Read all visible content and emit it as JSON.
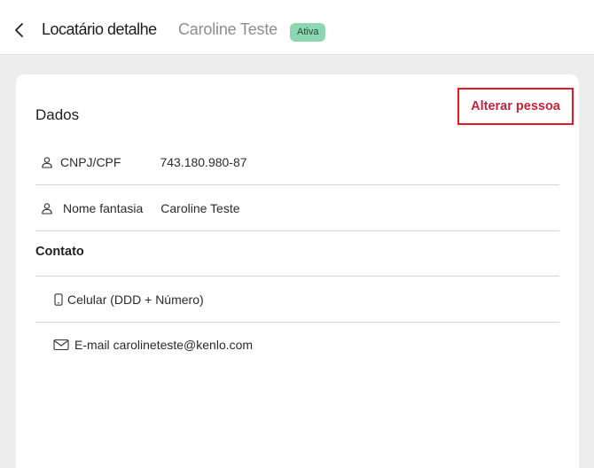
{
  "header": {
    "title": "Locatário detalhe",
    "subtitle": "Caroline Teste",
    "status_badge": "Ativa"
  },
  "colors": {
    "badge_bg": "#8dd6b2",
    "accent": "#c0243b",
    "highlight_border": "#e21b23"
  },
  "dados": {
    "title": "Dados",
    "alter_button": "Alterar pessoa",
    "rows": [
      {
        "label": "CNPJ/CPF",
        "value": "743.180.980-87",
        "icon": "user-icon"
      },
      {
        "label": "Nome fantasia",
        "value": "Caroline Teste",
        "icon": "user-icon"
      }
    ]
  },
  "contato": {
    "title": "Contato",
    "rows": [
      {
        "label": "Celular (DDD + Número)",
        "value": "",
        "icon": "phone-icon"
      },
      {
        "label": "E-mail",
        "value": "carolineteste@kenlo.com",
        "icon": "mail-icon"
      }
    ]
  }
}
